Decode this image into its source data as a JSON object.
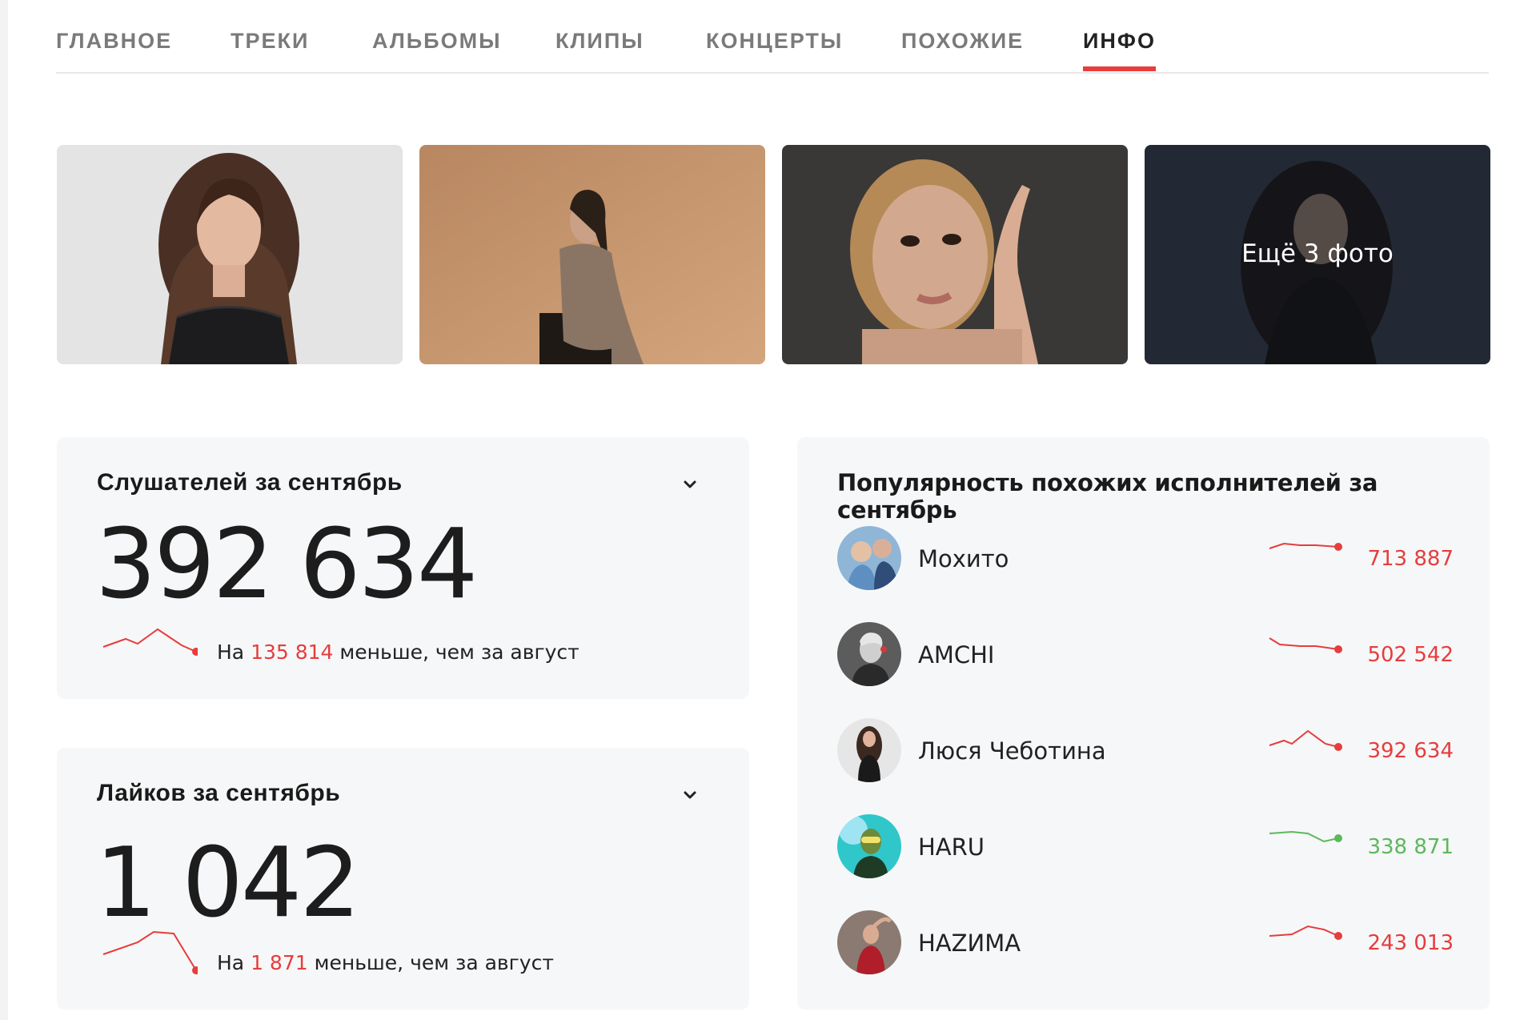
{
  "tabs": [
    {
      "label": "ГЛАВНОЕ",
      "active": false
    },
    {
      "label": "ТРЕКИ",
      "active": false
    },
    {
      "label": "АЛЬБОМЫ",
      "active": false
    },
    {
      "label": "КЛИПЫ",
      "active": false
    },
    {
      "label": "КОНЦЕРТЫ",
      "active": false
    },
    {
      "label": "ПОХОЖИЕ",
      "active": false
    },
    {
      "label": "ИНФО",
      "active": true
    }
  ],
  "photos": {
    "more_label": "Ещё 3 фото"
  },
  "listeners": {
    "title": "Слушателей за сентябрь",
    "value": "392 634",
    "delta_prefix": "На",
    "delta_value": "135 814",
    "delta_suffix": "меньше, чем за август"
  },
  "likes": {
    "title": "Лайков за сентябрь",
    "value": "1 042",
    "delta_prefix": "На",
    "delta_value": "1 871",
    "delta_suffix": "меньше, чем за август"
  },
  "similar": {
    "title": "Популярность похожих исполнителей за сентябрь",
    "artists": [
      {
        "name": "Мохито",
        "count": "713 887",
        "trend": "down"
      },
      {
        "name": "AMCHI",
        "count": "502 542",
        "trend": "down"
      },
      {
        "name": "Люся Чеботина",
        "count": "392 634",
        "trend": "down"
      },
      {
        "name": "HARU",
        "count": "338 871",
        "trend": "up"
      },
      {
        "name": "HAZИMA",
        "count": "243 013",
        "trend": "down"
      }
    ]
  },
  "colors": {
    "accent": "#e63d3d",
    "positive": "#5cb85c",
    "card_bg": "#f6f7f8"
  }
}
